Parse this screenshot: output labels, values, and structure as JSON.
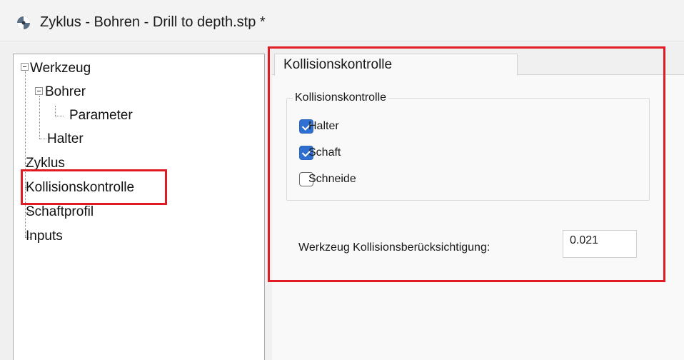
{
  "window": {
    "title": "Zyklus - Bohren  - Drill to depth.stp *"
  },
  "tree": {
    "items": [
      {
        "label": "Werkzeug",
        "level": 0,
        "expanded": true
      },
      {
        "label": "Bohrer",
        "level": 1,
        "expanded": true
      },
      {
        "label": "Parameter",
        "level": 2
      },
      {
        "label": "Halter",
        "level": 1
      },
      {
        "label": "Zyklus",
        "level": 0
      },
      {
        "label": "Kollisionskontrolle",
        "level": 0,
        "selected": true
      },
      {
        "label": "Schaftprofil",
        "level": 0
      },
      {
        "label": "Inputs",
        "level": 0
      }
    ]
  },
  "tabs": [
    {
      "label": "Kollisionskontrolle",
      "active": true
    }
  ],
  "group": {
    "label": "Kollisionskontrolle",
    "checkboxes": [
      {
        "label": "Halter",
        "checked": true
      },
      {
        "label": "Schaft",
        "checked": true
      },
      {
        "label": "Schneide",
        "checked": false
      }
    ]
  },
  "field": {
    "label": "Werkzeug Kollisionsberücksichtigung:",
    "value": "0.021"
  },
  "colors": {
    "highlight": "#e01b24",
    "checkbox_accent": "#2f6fd1"
  }
}
